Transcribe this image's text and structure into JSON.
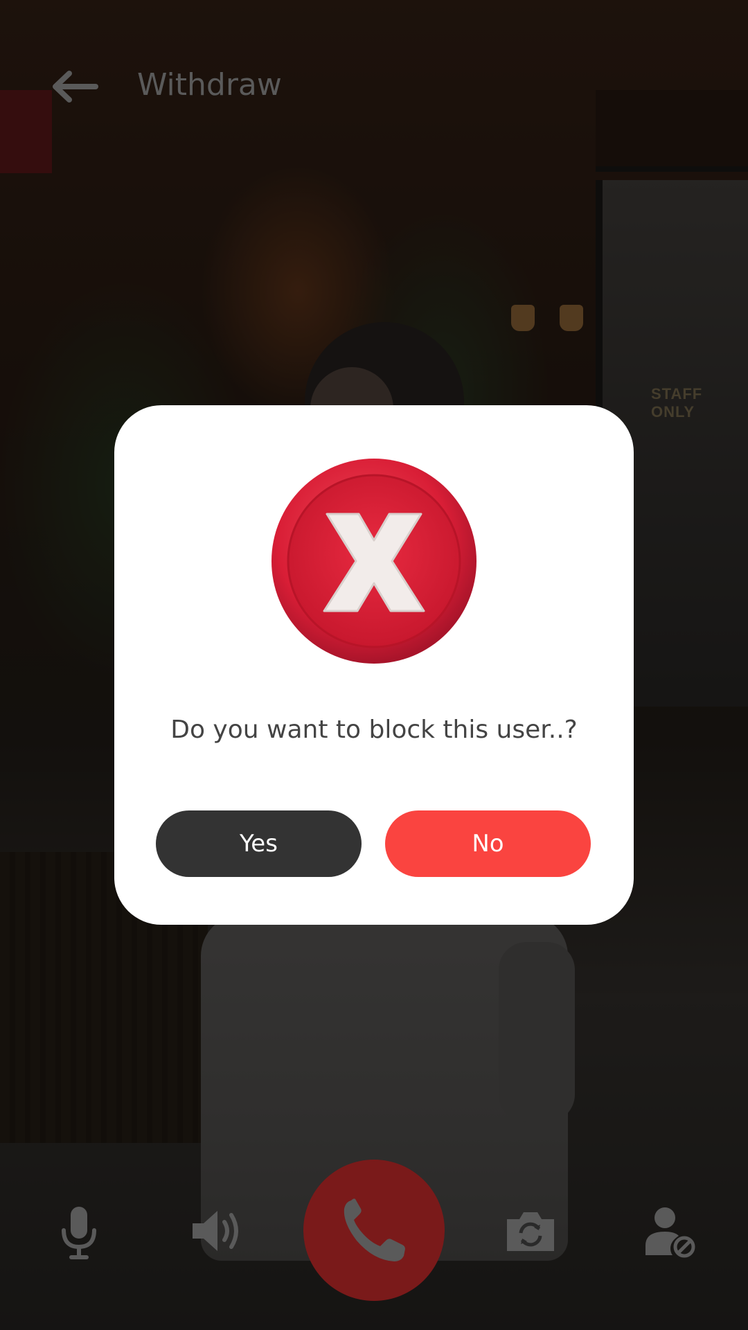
{
  "header": {
    "title": "Withdraw",
    "back_icon": "arrow-left-icon"
  },
  "background": {
    "sign_text": "STAFF ONLY"
  },
  "dialog": {
    "icon": "red-x-badge-icon",
    "message": "Do you want to block this user..?",
    "yes_label": "Yes",
    "no_label": "No",
    "colors": {
      "yes_button": "#333333",
      "no_button": "#fa4440",
      "badge_red": "#d91e36"
    }
  },
  "controls": {
    "items": [
      {
        "icon": "microphone-icon"
      },
      {
        "icon": "speaker-icon"
      },
      {
        "icon": "end-call-phone-icon"
      },
      {
        "icon": "switch-camera-icon"
      },
      {
        "icon": "block-user-icon"
      }
    ]
  }
}
